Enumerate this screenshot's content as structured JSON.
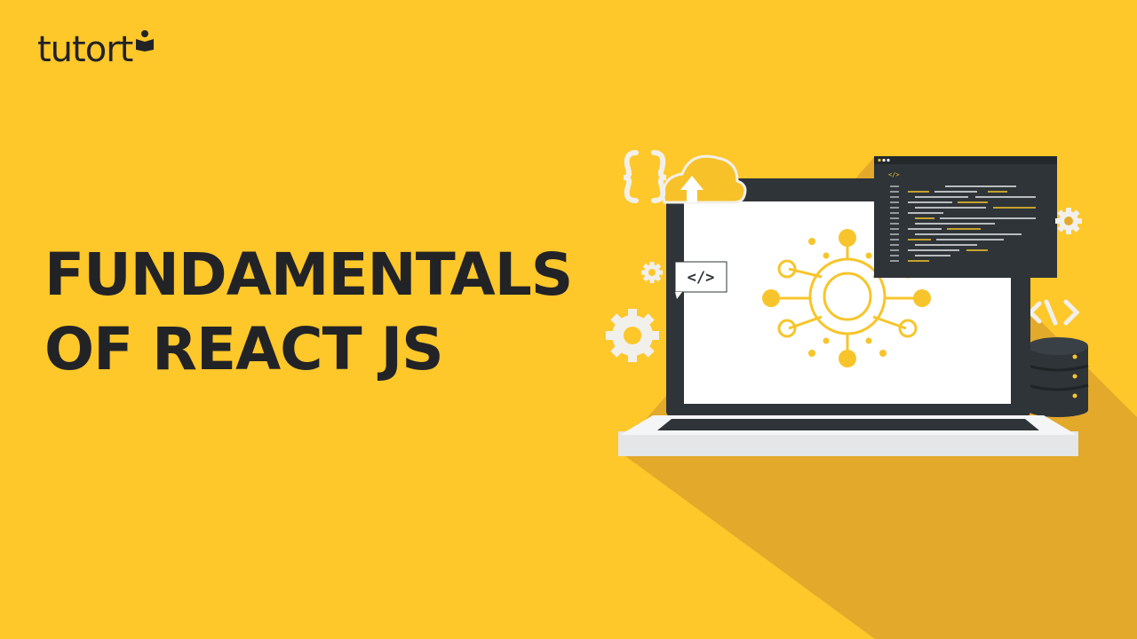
{
  "brand": {
    "name": "tutort"
  },
  "headline": {
    "line1": "FUNDAMENTALS",
    "line2": "OF REACT JS"
  },
  "illustration": {
    "code_tag_label": "</>",
    "bracket_glyph": "{ }",
    "angle_code_glyph": "<\\>",
    "icons": [
      "laptop-icon",
      "cloud-upload-icon",
      "code-editor-window",
      "server-stack-icon",
      "gear-icon",
      "network-hub-icon"
    ]
  },
  "colors": {
    "background": "#FEC72A",
    "shadow": "#E3A92A",
    "text_dark": "#222326",
    "accent_yellow": "#F7C52B",
    "screen_dark": "#2E3438",
    "screen_white": "#FFFFFF",
    "laptop_base": "#E4E6E8",
    "gear_white": "#F2F0EA"
  }
}
